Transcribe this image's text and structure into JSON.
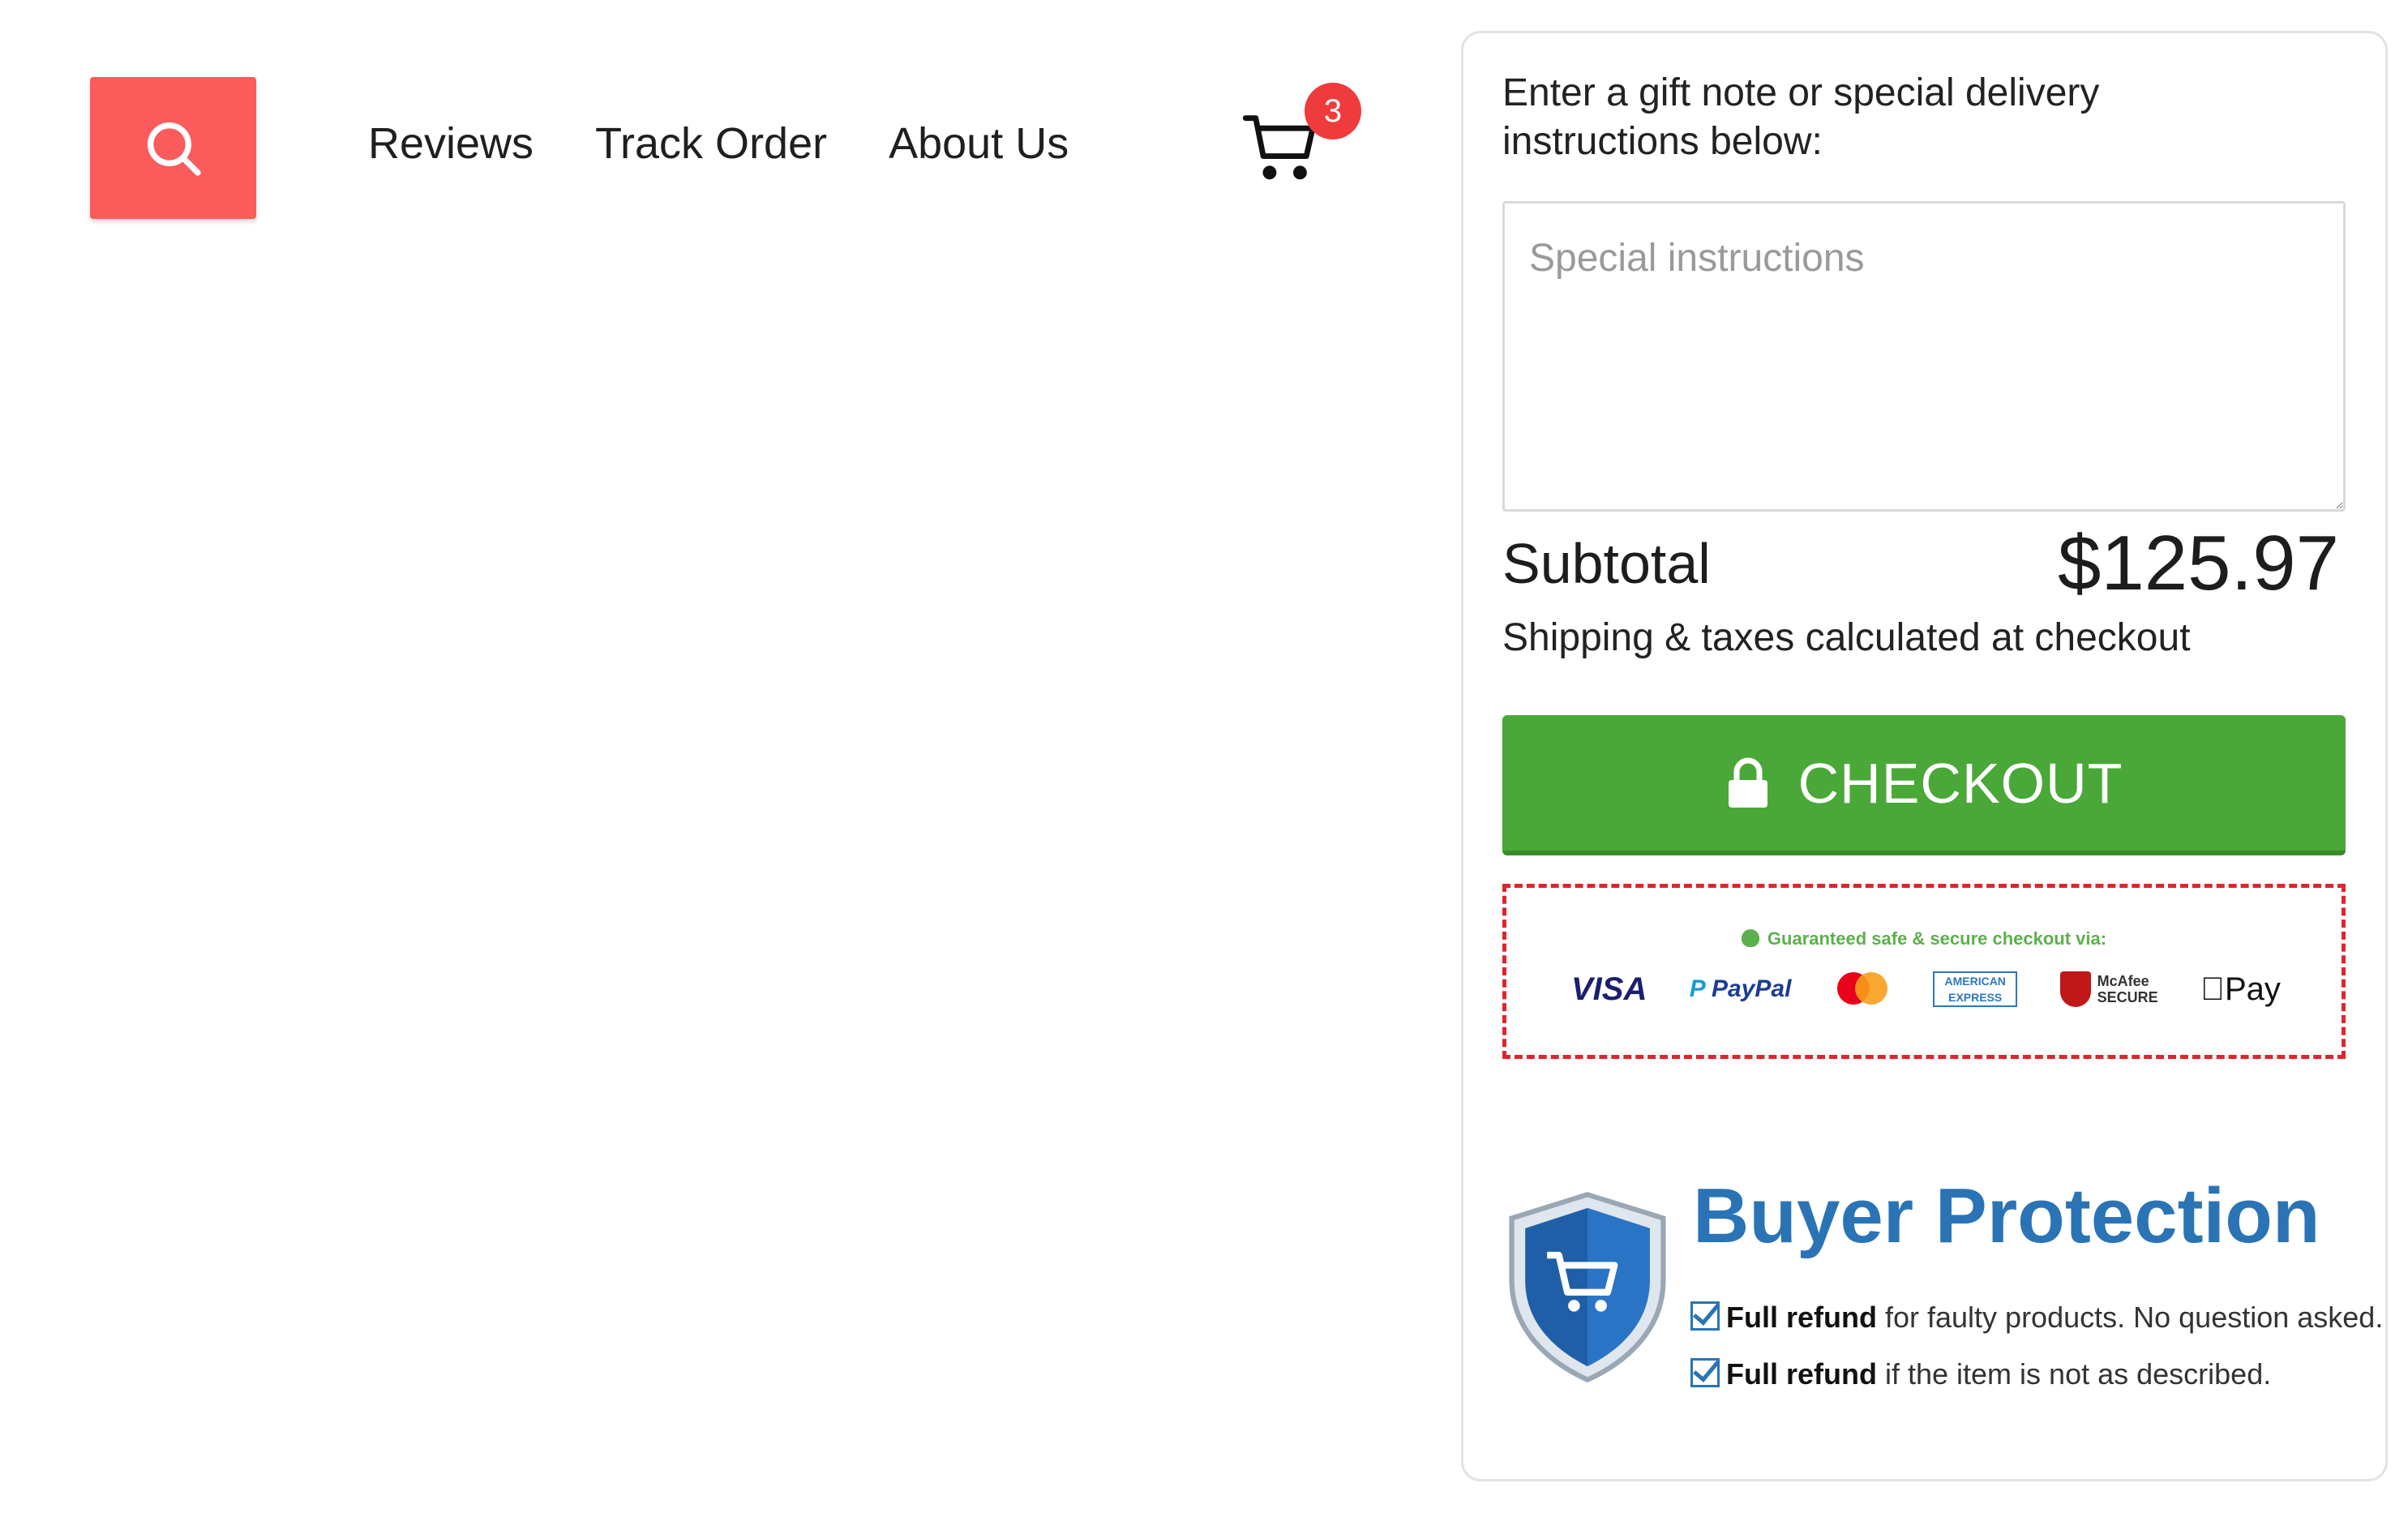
{
  "header": {
    "search_icon": "search-icon",
    "nav": [
      {
        "label": "Reviews"
      },
      {
        "label": "Track Order"
      },
      {
        "label": "About Us"
      }
    ],
    "cart_icon": "shopping-cart-icon",
    "cart_count": "3"
  },
  "cart_panel": {
    "note_label": "Enter a gift note or special delivery instructions below:",
    "instructions_placeholder": "Special instructions",
    "instructions_value": "",
    "subtotal_label": "Subtotal",
    "subtotal_value": "$125.97",
    "shipping_note": "Shipping & taxes calculated at checkout",
    "checkout_label": "CHECKOUT",
    "checkout_icon": "lock-icon",
    "secure_caption": "Guaranteed safe & secure checkout via:",
    "payment_methods": [
      "VISA",
      "PayPal",
      "Mastercard",
      "American Express",
      "McAfee SECURE",
      "Apple Pay"
    ],
    "buyer_protection": {
      "title": "Buyer Protection",
      "line1_bold": "Full refund",
      "line1_rest": " for faulty products. No question asked.",
      "line2_bold": "Full refund",
      "line2_rest": " if the item is not as described."
    }
  },
  "colors": {
    "search_button": "#fa5b5b",
    "checkout_button": "#4aa838",
    "badge": "#ef3b3b",
    "protection_blue": "#2a74b6",
    "secure_border": "#e0242f"
  }
}
